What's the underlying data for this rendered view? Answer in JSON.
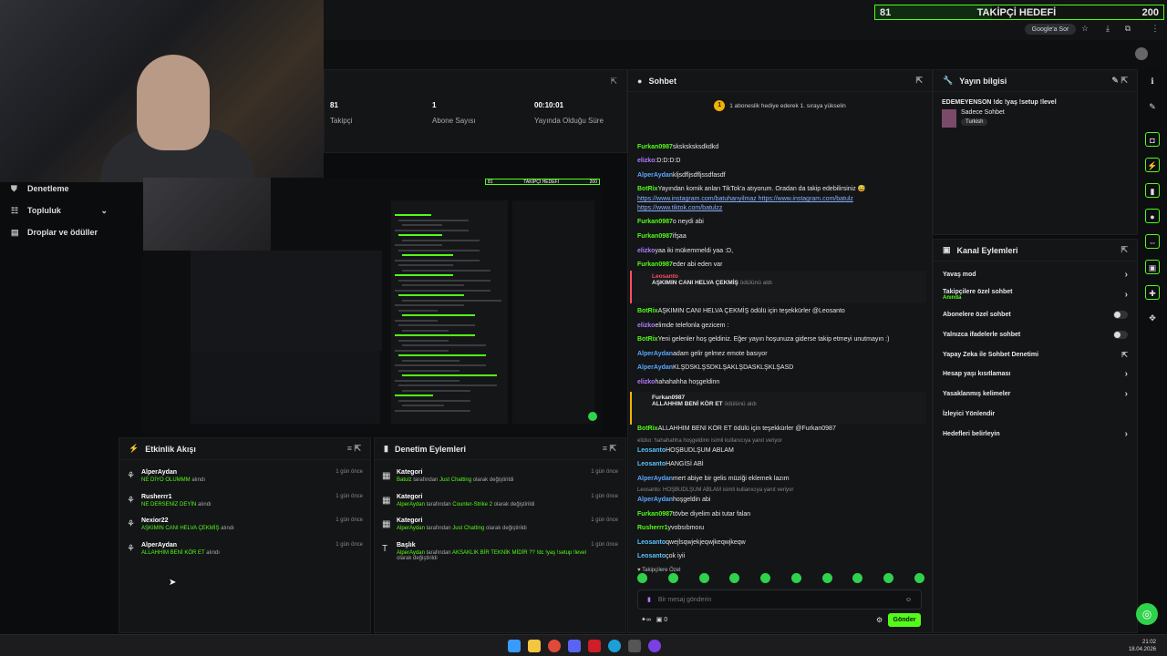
{
  "goal": {
    "current": "81",
    "title": "TAKİPÇİ HEDEFİ",
    "target": "200",
    "progress": 0.405
  },
  "browser": {
    "google_label": "Google'a Sor"
  },
  "sidebar": {
    "items": [
      {
        "label": "Denetleme",
        "icon": "shield-icon"
      },
      {
        "label": "Topluluk",
        "icon": "people-icon"
      },
      {
        "label": "Droplar ve ödüller",
        "icon": "gift-icon"
      }
    ]
  },
  "stats": [
    {
      "value": "81",
      "label": "Takipçi"
    },
    {
      "value": "1",
      "label": "Abone Sayısı"
    },
    {
      "value": "00:10:01",
      "label": "Yayında Olduğu Süre"
    }
  ],
  "activity": {
    "title": "Etkinlik Akışı",
    "items": [
      {
        "name": "AlperAydan",
        "reward": "NE DİYO OLUMMM",
        "suffix": "alındı",
        "time": "1 gün önce"
      },
      {
        "name": "Rusherrr1",
        "reward": "NE DERSENİZ DEYİN",
        "suffix": "alındı",
        "time": "1 gün önce"
      },
      {
        "name": "Nexior22",
        "reward": "AŞKIMIN CANI HELVA ÇEKMİŞ",
        "suffix": "alındı",
        "time": "1 gün önce"
      },
      {
        "name": "AlperAydan",
        "reward": "ALLAHHIM BENİ KÖR ET",
        "suffix": "alındı",
        "time": "1 gün önce"
      }
    ]
  },
  "moderation": {
    "title": "Denetim Eylemleri",
    "items": [
      {
        "title": "Kategori",
        "user": "Batulz",
        "mid": "tarafından",
        "value": "Just Chatting",
        "tail": "olarak değiştirildi",
        "time": "1 gün önce"
      },
      {
        "title": "Kategori",
        "user": "AlperAydan",
        "mid": "tarafından",
        "value": "Counter-Strike 2",
        "tail": "olarak değiştirildi",
        "time": "1 gün önce"
      },
      {
        "title": "Kategori",
        "user": "AlperAydan",
        "mid": "tarafından",
        "value": "Just Chatting",
        "tail": "olarak değiştirildi",
        "time": "1 gün önce"
      },
      {
        "title": "Başlık",
        "user": "AlperAydan",
        "mid": "tarafından",
        "value": "AKSAKLIK BİR TEKNİK MİDİR ?? !dc !yaş !setup !level",
        "tail": "olarak değiştirildi",
        "time": "1 gün önce"
      }
    ]
  },
  "chat": {
    "title": "Sohbet",
    "pinned": "1 aboneslik hediye ederek 1. sıraya yükselin",
    "messages": [
      {
        "user": "Furkan0987",
        "color": "green",
        "text": "sksksksksdkdkd"
      },
      {
        "user": "elizko",
        "color": "pink",
        "text": ":D:D:D:D"
      },
      {
        "user": "AlperAydan",
        "color": "blue",
        "text": "kljsdfljsdfljssdfasdf"
      },
      {
        "user": "BotRix",
        "color": "green",
        "text": "Yayından komik anları TikTok'a atıyorum. Oradan da takip edebilirsiniz 😅"
      },
      {
        "user": "",
        "color": "",
        "text": "https://www.instagram.com/batuhanyilmaz https://www.instagram.com/batulz"
      },
      {
        "user": "",
        "color": "",
        "text": "https://www.tiktok.com/batulzz"
      },
      {
        "user": "Furkan0987",
        "color": "green",
        "text": "o neydi abi"
      },
      {
        "user": "Furkan0987",
        "color": "green",
        "text": "ifşaa"
      },
      {
        "user": "elizko",
        "color": "pink",
        "text": "yaa iki mükemmeldi yaa :D,"
      },
      {
        "user": "Furkan0987",
        "color": "green",
        "text": "eder abi eden var"
      },
      {
        "user": "BotRix",
        "color": "green",
        "text": "AŞKIMIN CANI HELVA ÇEKMİŞ ödülü için teşekkürler @Leosanto"
      },
      {
        "user": "elizko",
        "color": "pink",
        "text": "elimde telefonla gezicem :"
      },
      {
        "user": "BotRix",
        "color": "green",
        "text": "Yeni gelenler hoş geldiniz. Eğer yayın hoşunuza giderse takip etmeyi unutmayın :)"
      },
      {
        "user": "AlperAydan",
        "color": "blue",
        "text": "adam gelir gelmez emote basıyor"
      },
      {
        "user": "AlperAydan",
        "color": "blue",
        "text": "KLŞDSKLŞSDKLŞAKLŞDASKLŞKLŞASD"
      },
      {
        "user": "elizko",
        "color": "pink",
        "text": "hahahahha hoşgeldinn"
      },
      {
        "user": "BotRix",
        "color": "green",
        "text": "ALLAHHIM BENİ KÖR ET ödülü için teşekkürler @Furkan0987"
      },
      {
        "user": "Leosanto",
        "color": "teal",
        "text": "HOŞBUDLŞUM ABLAM"
      },
      {
        "user": "Leosanto",
        "color": "teal",
        "text": "HANGİSİ ABİ"
      },
      {
        "user": "AlperAydan",
        "color": "blue",
        "text": "mert abiye bir gelis müziği eklemek lazım"
      },
      {
        "user": "AlperAydan",
        "color": "blue",
        "text": "hoşgeldin abi"
      },
      {
        "user": "Furkan0987",
        "color": "green",
        "text": "tövbe diyelim abi tutar falan"
      },
      {
        "user": "Rusherrr1",
        "color": "green",
        "text": "yvobsıbmoıu"
      },
      {
        "user": "Leosanto",
        "color": "teal",
        "text": "qwejlsqwjekjeqwjkeqwjkeqw"
      },
      {
        "user": "Leosanto",
        "color": "teal",
        "text": "çok iyii"
      }
    ],
    "redeem1": {
      "user": "Leosanto",
      "text": "AŞKIMIN CANI HELVA ÇEKMİŞ",
      "suffix": "ödülünü aldı"
    },
    "redeem2": {
      "user": "Furkan0987",
      "text": "ALLAHHIM BENİ KÖR ET",
      "suffix": "ödülünü aldı"
    },
    "reply1": "elizko: hahahahha hoşgeldinn isimli kullanıcıya yanıt veriyor",
    "reply2": "Leosanto: HOŞBUDLŞUM ABLAM isimli kullanıcıya yanıt veriyor",
    "followers_only": "Takipçilere Özel",
    "input_placeholder": "Bir mesaj gönderin",
    "points": "0",
    "send_label": "Gönder"
  },
  "stream_info": {
    "title": "Yayın bilgisi",
    "stream_title": "EDEMEYENSON !dc !yaş !setup !level",
    "category": "Sadece Sohbet",
    "language": "Turkish"
  },
  "channel_actions": {
    "title": "Kanal Eylemleri",
    "rows": [
      {
        "label": "Yavaş mod",
        "type": "chevron"
      },
      {
        "label": "Takipçilere özel sohbet",
        "sub": "Anında",
        "type": "chevron"
      },
      {
        "label": "Abonelere özel sohbet",
        "type": "toggle"
      },
      {
        "label": "Yalnızca ifadelerle sohbet",
        "type": "toggle"
      },
      {
        "label": "Yapay Zeka ile Sohbet Denetimi",
        "type": "external"
      },
      {
        "label": "Hesap yaşı kısıtlaması",
        "type": "chevron"
      },
      {
        "label": "Yasaklanmış kelimeler",
        "type": "chevron"
      },
      {
        "label": "İzleyici Yönlendir",
        "type": "none"
      },
      {
        "label": "Hedefleri belirleyin",
        "type": "chevron"
      }
    ]
  },
  "clock": {
    "time": "21:02",
    "date": "18.04.2026"
  },
  "colors": {
    "accent": "#53fc18",
    "panel": "#141517",
    "bg": "#0b0c0e"
  }
}
